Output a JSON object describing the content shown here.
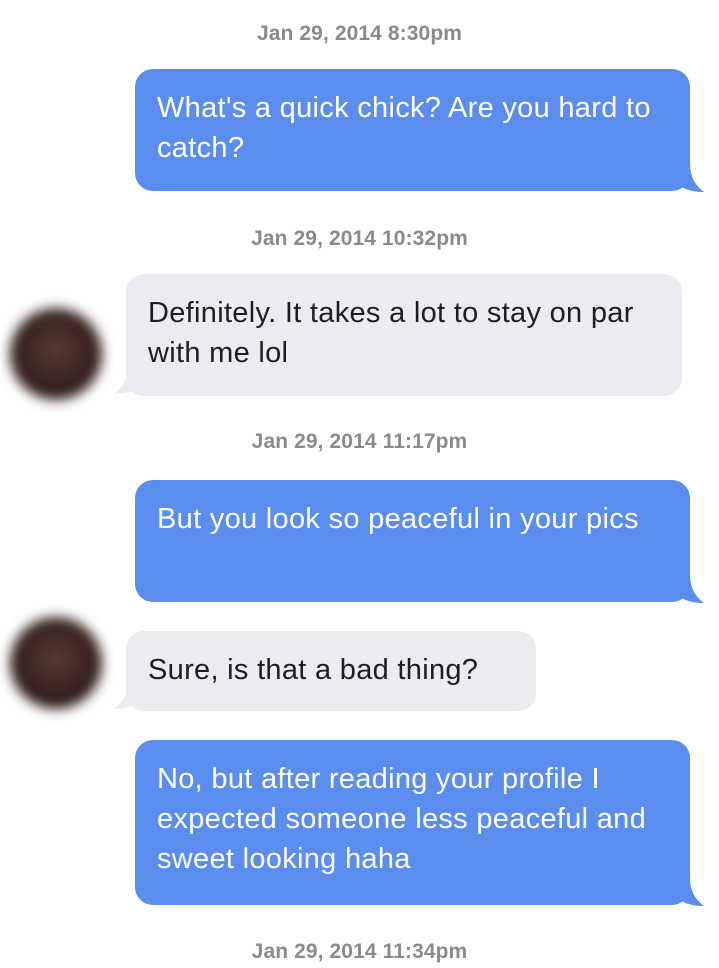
{
  "conversation": {
    "messages": [
      {
        "type": "timestamp",
        "text": "Jan 29, 2014 8:30pm"
      },
      {
        "type": "sent",
        "text": "What's a quick chick? Are you hard to catch?"
      },
      {
        "type": "timestamp",
        "text": "Jan 29, 2014 10:32pm"
      },
      {
        "type": "received",
        "text": "Definitely. It takes a lot to stay on par with me lol"
      },
      {
        "type": "timestamp",
        "text": "Jan 29, 2014 11:17pm"
      },
      {
        "type": "sent",
        "text": "But you look so peaceful in your pics"
      },
      {
        "type": "received",
        "text": "Sure, is that a bad thing?"
      },
      {
        "type": "sent",
        "text": "No, but after reading your profile I expected someone less peaceful and sweet looking haha"
      },
      {
        "type": "timestamp",
        "text": "Jan 29, 2014 11:34pm"
      }
    ]
  },
  "colors": {
    "sent_bubble": "#5a8ded",
    "received_bubble": "#ececf0",
    "timestamp_text": "#8a8a8a"
  }
}
